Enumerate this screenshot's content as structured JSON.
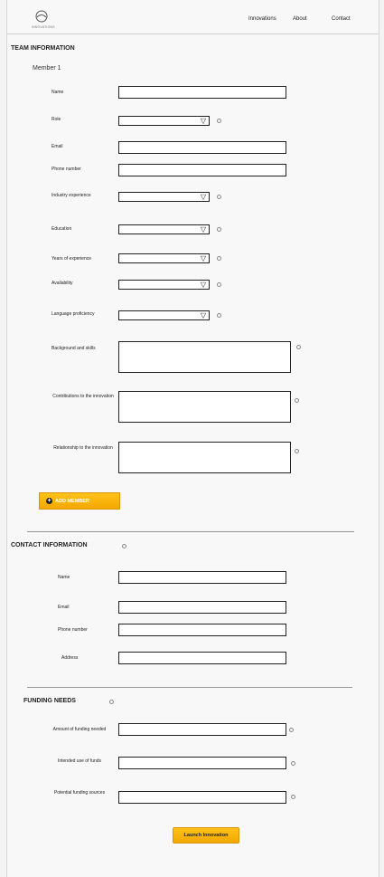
{
  "header": {
    "logo_text": "INNOVATIONS",
    "nav": [
      "Innovations",
      "About",
      "Contact"
    ]
  },
  "team": {
    "title": "TEAM INFORMATION",
    "member_label": "Member 1",
    "fields": {
      "name": "Name",
      "role": "Role",
      "email": "Email",
      "phone": "Phone number",
      "industry": "Industry experience",
      "education": "Education",
      "years": "Years of experience",
      "availability": "Availability",
      "language": "Language proficiency",
      "background": "Background and skills",
      "contributions": "Contributions to the innovation",
      "relationship": "Relationship to the innovation"
    },
    "add_member_label": "ADD MEMBER"
  },
  "contact": {
    "title": "CONTACT INFORMATION",
    "fields": {
      "name": "Name",
      "email": "Email",
      "phone": "Phone number",
      "address": "Address"
    }
  },
  "funding": {
    "title": "FUNDING NEEDS",
    "fields": {
      "amount": "Amount of funding needed",
      "use": "Intended use of funds",
      "sources": "Potential funding sources"
    }
  },
  "launch_label": "Launch Innovation"
}
